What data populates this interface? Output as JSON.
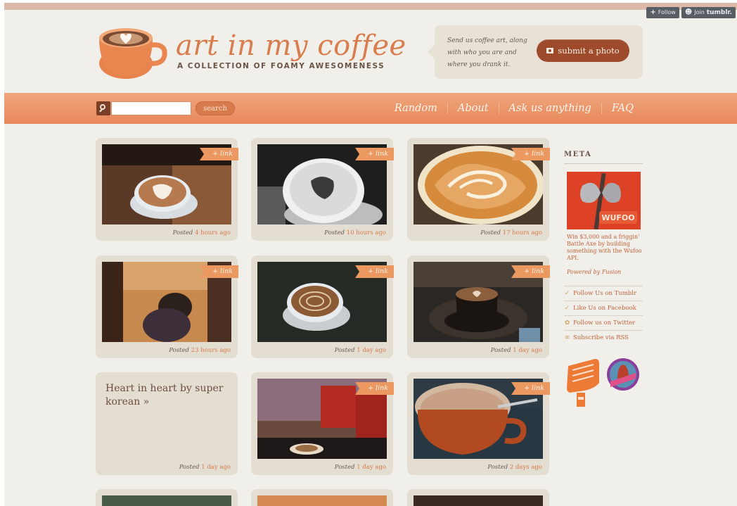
{
  "tumblr_bar": {
    "follow_label": "Follow",
    "join_label": "Join",
    "join_brand": "tumblr."
  },
  "header": {
    "title": "art in my coffee",
    "tagline": "A COLLECTION OF FOAMY AWESOMENESS",
    "submit_text": "Send us coffee art, along with who you are and where you drank it.",
    "submit_button": "submit a photo"
  },
  "nav": {
    "search_placeholder": "",
    "search_button": "search",
    "links": [
      "Random",
      "About",
      "Ask us anything",
      "FAQ"
    ]
  },
  "posts": [
    {
      "tag": "+ link",
      "posted_label": "Posted",
      "time": "4 hours ago"
    },
    {
      "tag": "+ link",
      "posted_label": "Posted",
      "time": "10 hours ago"
    },
    {
      "tag": "+ link",
      "posted_label": "Posted",
      "time": "17 hours ago"
    },
    {
      "tag": "+ link",
      "posted_label": "Posted",
      "time": "23 hours ago"
    },
    {
      "tag": "+ link",
      "posted_label": "Posted",
      "time": "1 day ago"
    },
    {
      "tag": "+ link",
      "posted_label": "Posted",
      "time": "1 day ago"
    },
    {
      "title": "Heart in heart by super korean »",
      "posted_label": "Posted",
      "time": "1 day ago"
    },
    {
      "tag": "+ link",
      "posted_label": "Posted",
      "time": "1 day ago"
    },
    {
      "tag": "+ link",
      "posted_label": "Posted",
      "time": "2 days ago"
    }
  ],
  "sidebar": {
    "meta_heading": "META",
    "ad_logo": "WUFOO",
    "ad_text": "Win $3,000 and a friggin' Battle Axe by building something with the Wufoo API.",
    "ad_powered": "Powered by Fusion",
    "social": [
      {
        "icon": "check-icon",
        "label": "Follow Us on Tumblr"
      },
      {
        "icon": "check-icon",
        "label": "Like Us on Facebook"
      },
      {
        "icon": "bird-icon",
        "label": "Follow us on Twitter"
      },
      {
        "icon": "rss-icon",
        "label": "Subscribe via RSS"
      }
    ]
  },
  "colors": {
    "accent": "#e7875a",
    "brand_brown": "#9d4b2b",
    "link": "#c06238"
  }
}
